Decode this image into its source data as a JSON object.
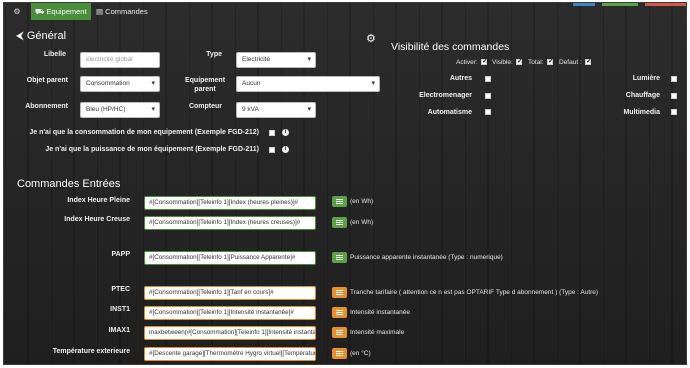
{
  "tabs": {
    "home_icon": "gear-icon",
    "equipment": "Equipement",
    "commands": "Commandes"
  },
  "general": {
    "title": "Général",
    "libelle_label": "Libelle",
    "libelle_placeholder": "électricité global",
    "type_label": "Type",
    "type_value": "Electricité",
    "objet_parent_label": "Objet parent",
    "objet_parent_value": "Consommation",
    "equip_parent_label": "Equipement parent",
    "equip_parent_value": "Aucun",
    "abonnement_label": "Abonnement",
    "abonnement_value": "Bleu (HP/HC)",
    "compteur_label": "Compteur",
    "compteur_value": "9 kVA",
    "conso_only_label": "Je n'ai que la consommation de mon equipement (Exemple FGD-212)",
    "puissance_only_label": "Je n'ai que la puissance de mon équipement (Exemple FGD-211)"
  },
  "visibility": {
    "title": "Visibilité des commandes",
    "activer": "Activer:",
    "visible": "Visible:",
    "total": "Total:",
    "defaut": "Defaut :",
    "items": [
      "Autres",
      "Lumière",
      "Electromenager",
      "Chauffage",
      "Automatisme",
      "Multimedia"
    ]
  },
  "commands": {
    "title": "Commandes Entrées",
    "rows": [
      {
        "label": "Index Heure Pleine",
        "value": "#[Consommation][Teleinfo 1][Index (heures pleines)]#",
        "unit": "(en Wh)",
        "color": "green"
      },
      {
        "label": "Index Heure Creuse",
        "value": "#[Consommation][Teleinfo 1][Index (heures creuses)]#",
        "unit": "(en Wh)",
        "color": "green"
      },
      {
        "label": "PAPP",
        "value": "#[Consommation][Teleinfo 1][Puissance Apparente]#",
        "unit": "Puissance apparente instantanée (Type : numerique)",
        "color": "green"
      },
      {
        "label": "PTEC",
        "value": "#[Consommation][Teleinfo 1][Tarif en cours]#",
        "unit": "Tranche tarifaire ( attention ce n est pas OPTARIF Type d abonnement ) (Type : Autre)",
        "color": "orange"
      },
      {
        "label": "INST1",
        "value": "#[Consommation][Teleinfo 1][Intensité instantanée]#",
        "unit": "Intensité instantanée",
        "color": "orange"
      },
      {
        "label": "IMAX1",
        "value": "maxbetween(#[Consommation][Teleinfo 1][Intensité instantanée]#",
        "unit": "Intensité maximale",
        "color": "orange"
      },
      {
        "label": "Température exterieure",
        "value": "#[Descente garage][Thermomètre Hygro virtuel][Température]#",
        "unit": "(en °C)",
        "color": "orange"
      }
    ]
  },
  "colors": {
    "green": "#4a8d3a",
    "orange": "#e8912c"
  }
}
